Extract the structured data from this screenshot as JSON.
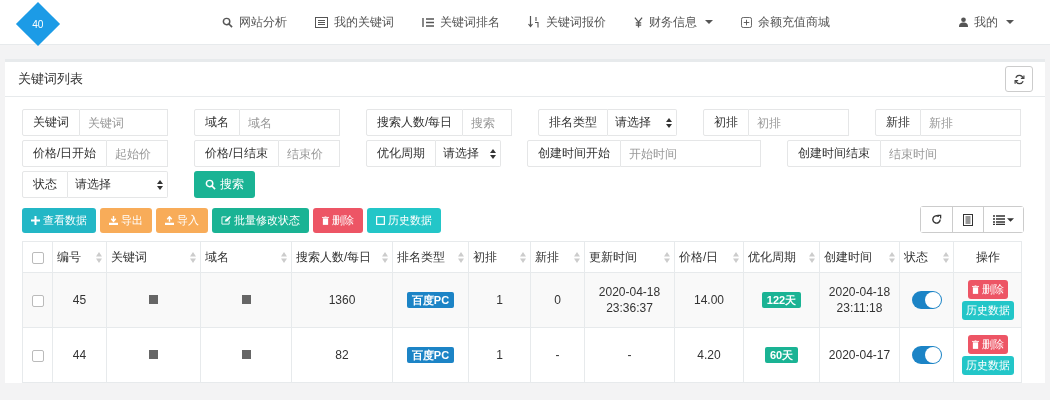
{
  "header": {
    "logo_text": "40",
    "nav": [
      {
        "label": "网站分析",
        "kind": "search",
        "dropdown": false
      },
      {
        "label": "我的关键词",
        "kind": "card",
        "dropdown": false
      },
      {
        "label": "关键词排名",
        "kind": "list",
        "dropdown": false
      },
      {
        "label": "关键词报价",
        "kind": "sort",
        "dropdown": false
      },
      {
        "label": "财务信息",
        "kind": "yen",
        "dropdown": true
      },
      {
        "label": "余额充值商城",
        "kind": "plus",
        "dropdown": false
      }
    ],
    "user": {
      "label": "我的",
      "dropdown": true
    }
  },
  "panel": {
    "title": "关键词列表"
  },
  "filters": [
    [
      {
        "label": "关键词",
        "kind": "input",
        "placeholder": "关键词"
      },
      {
        "label": "域名",
        "kind": "input",
        "placeholder": "域名"
      },
      {
        "label": "搜索人数/每日",
        "kind": "input",
        "placeholder": "搜索"
      },
      {
        "label": "排名类型",
        "kind": "select",
        "value": "请选择"
      },
      {
        "label": "初排",
        "kind": "input",
        "placeholder": "初排"
      },
      {
        "label": "新排",
        "kind": "input",
        "placeholder": "新排"
      }
    ],
    [
      {
        "label": "价格/日开始",
        "kind": "input",
        "placeholder": "起始价"
      },
      {
        "label": "价格/日结束",
        "kind": "input",
        "placeholder": "结束价"
      },
      {
        "label": "优化周期",
        "kind": "select",
        "value": "请选择"
      },
      {
        "label": "创建时间开始",
        "kind": "input",
        "placeholder": "开始时间"
      },
      {
        "label": "创建时间结束",
        "kind": "input",
        "placeholder": "结束时间"
      }
    ],
    [
      {
        "label": "状态",
        "kind": "select",
        "value": "请选择"
      }
    ]
  ],
  "search_button": "搜索",
  "actions": [
    {
      "label": "查看数据",
      "kind": "add"
    },
    {
      "label": "导出",
      "kind": "export"
    },
    {
      "label": "导入",
      "kind": "import"
    },
    {
      "label": "批量修改状态",
      "kind": "edit"
    },
    {
      "label": "删除",
      "kind": "delete"
    },
    {
      "label": "历史数据",
      "kind": "history"
    }
  ],
  "table": {
    "select_all_checked": false,
    "columns": [
      {
        "label": "编号",
        "sortable": true
      },
      {
        "label": "关键词",
        "sortable": true
      },
      {
        "label": "域名",
        "sortable": true
      },
      {
        "label": "搜索人数/每日",
        "sortable": true
      },
      {
        "label": "排名类型",
        "sortable": true
      },
      {
        "label": "初排",
        "sortable": true
      },
      {
        "label": "新排",
        "sortable": true
      },
      {
        "label": "更新时间",
        "sortable": true
      },
      {
        "label": "价格/日",
        "sortable": true
      },
      {
        "label": "优化周期",
        "sortable": true
      },
      {
        "label": "创建时间",
        "sortable": true
      },
      {
        "label": "状态",
        "sortable": true
      },
      {
        "label": "操作",
        "sortable": false
      }
    ],
    "rows": [
      {
        "checked": false,
        "id": "45",
        "search_count": "1360",
        "rank_type": "百度PC",
        "first_rank": "1",
        "new_rank": "0",
        "updated": [
          "2020-04-18",
          "23:36:37"
        ],
        "price": "14.00",
        "period": "122天",
        "created": [
          "2020-04-18",
          "23:11:18"
        ],
        "on": true,
        "row_actions": [
          "删除",
          "历史数据"
        ]
      },
      {
        "checked": false,
        "id": "44",
        "search_count": "82",
        "rank_type": "百度PC",
        "first_rank": "1",
        "new_rank": "-",
        "updated": [
          "-"
        ],
        "price": "4.20",
        "period": "60天",
        "created": [
          "2020-04-17"
        ],
        "on": true,
        "row_actions": [
          "删除",
          "历史数据"
        ]
      }
    ]
  }
}
